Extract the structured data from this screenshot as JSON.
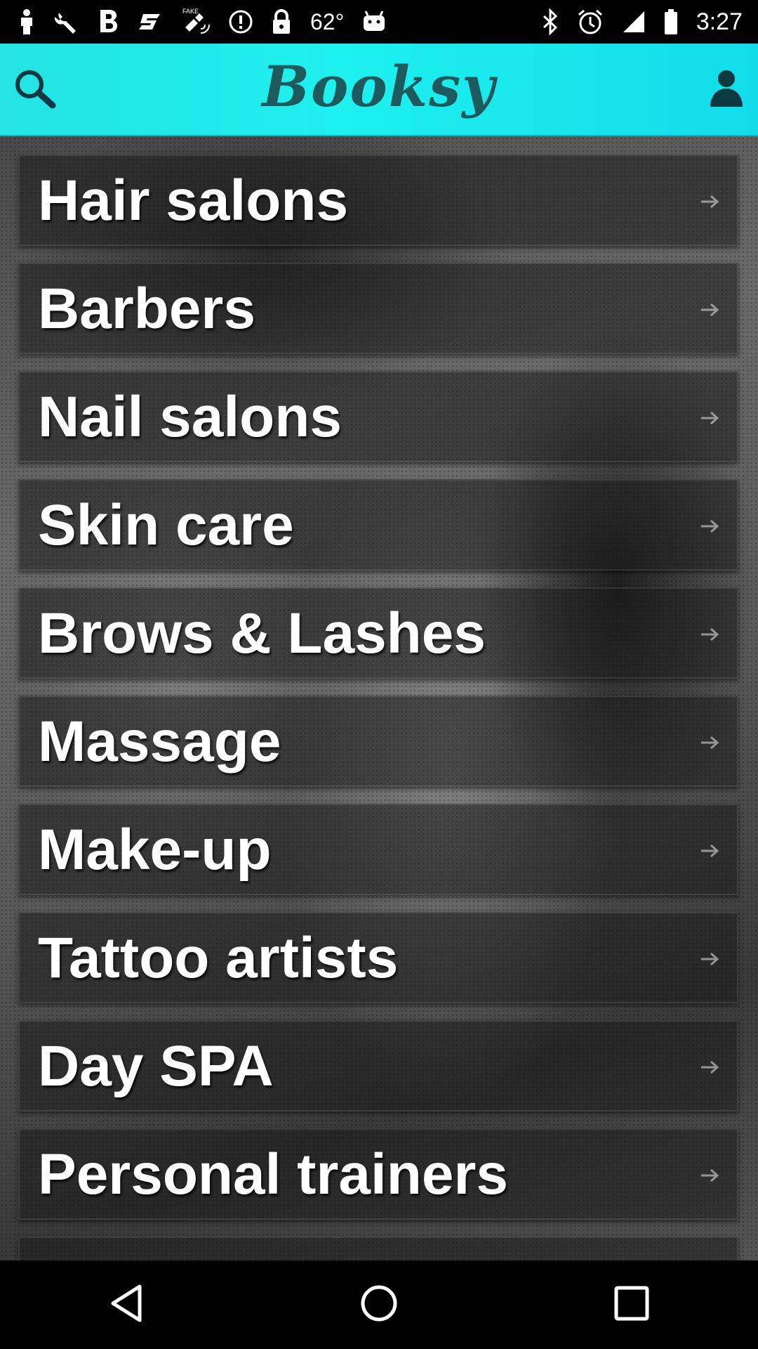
{
  "status_bar": {
    "temperature": "62°",
    "time": "3:27",
    "icons": [
      "person-icon",
      "wrench-icon",
      "bold-b-icon",
      "s-logo-icon",
      "fake-gps-icon",
      "info-icon",
      "lock-icon",
      "android-icon",
      "bluetooth-icon",
      "alarm-icon",
      "signal-icon",
      "battery-icon"
    ]
  },
  "header": {
    "logo_text": "Booksy",
    "accent_color": "#1ef0ee",
    "search_icon": "search-icon",
    "profile_icon": "user-icon"
  },
  "categories": [
    {
      "label": "Hair salons"
    },
    {
      "label": "Barbers"
    },
    {
      "label": "Nail salons"
    },
    {
      "label": "Skin care"
    },
    {
      "label": "Brows & Lashes"
    },
    {
      "label": "Massage"
    },
    {
      "label": "Make-up"
    },
    {
      "label": "Tattoo artists"
    },
    {
      "label": "Day SPA"
    },
    {
      "label": "Personal trainers"
    }
  ],
  "nav": {
    "icons": [
      "back-icon",
      "home-icon",
      "recents-icon"
    ]
  }
}
